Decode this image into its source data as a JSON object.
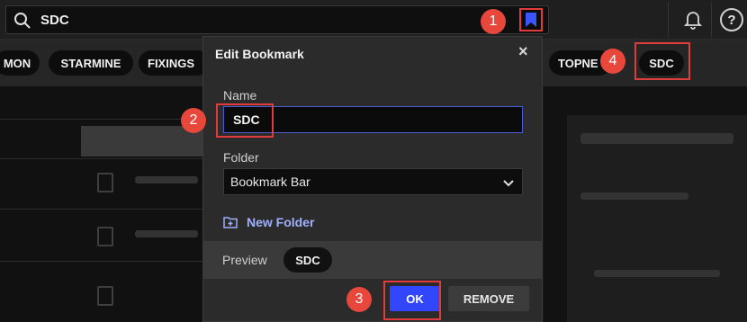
{
  "search": {
    "query": "SDC"
  },
  "chips": [
    "MON",
    "STARMINE",
    "FIXINGS",
    "TOPNE",
    "SDC"
  ],
  "dialog": {
    "title": "Edit Bookmark",
    "close": "×",
    "name_label": "Name",
    "name_value": "SDC",
    "folder_label": "Folder",
    "folder_value": "Bookmark Bar",
    "new_folder": "New Folder",
    "preview_label": "Preview",
    "preview_value": "SDC",
    "ok_label": "OK",
    "remove_label": "REMOVE"
  },
  "help_glyph": "?",
  "markers": [
    "1",
    "2",
    "3",
    "4"
  ],
  "colors": {
    "accent": "#3246ff",
    "marker": "#e8473b",
    "link": "#9fb0ff"
  }
}
